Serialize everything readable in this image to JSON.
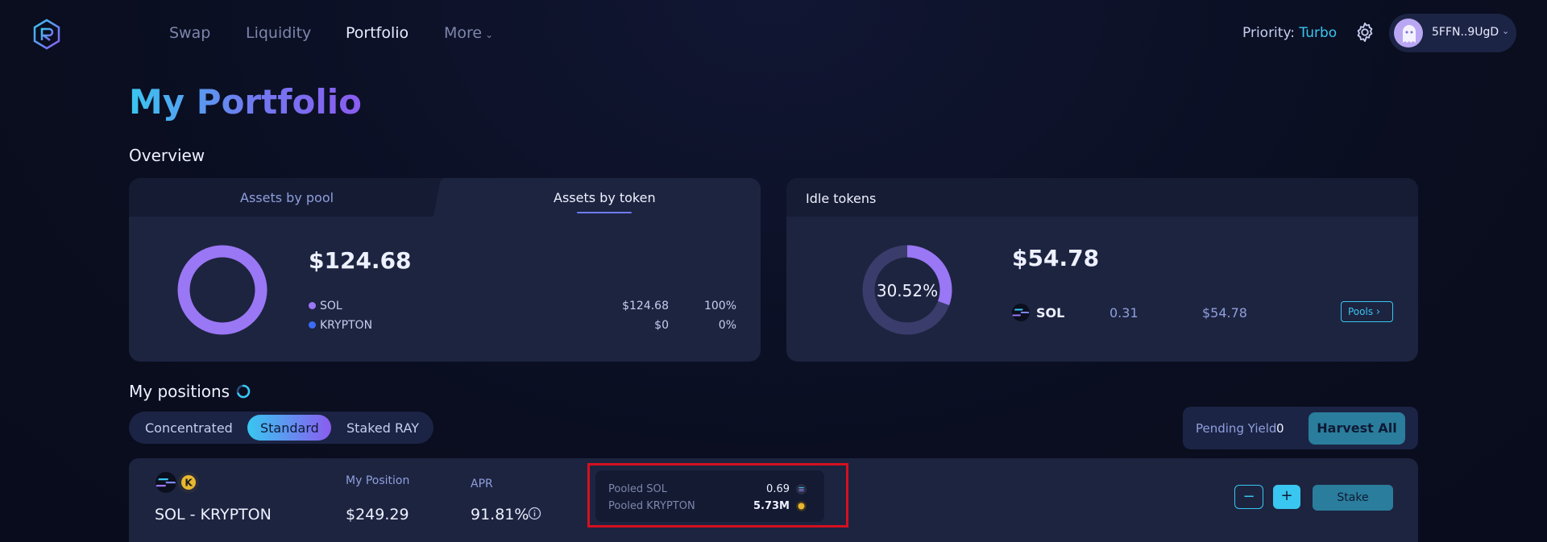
{
  "nav": {
    "links": [
      "Swap",
      "Liquidity",
      "Portfolio",
      "More"
    ],
    "priority_label": "Priority:",
    "priority_value": "Turbo",
    "wallet_address": "5FFN..9UgD"
  },
  "page": {
    "title": "My Portfolio",
    "overview_title": "Overview",
    "positions_title": "My positions"
  },
  "assets_card": {
    "tabs": [
      "Assets by pool",
      "Assets by token"
    ],
    "active_tab": "Assets by token",
    "total": "$124.68",
    "rows": [
      {
        "token": "SOL",
        "value": "$124.68",
        "percent": "100%",
        "color": "#9a77f4"
      },
      {
        "token": "KRYPTON",
        "value": "$0",
        "percent": "0%",
        "color": "#3b6cf5"
      }
    ],
    "donut_fraction": 1.0
  },
  "idle_card": {
    "title": "Idle tokens",
    "total": "$54.78",
    "donut_label": "30.52%",
    "donut_fraction": 0.3052,
    "token": "SOL",
    "amount": "0.31",
    "value": "$54.78",
    "pools_button": "Pools"
  },
  "positions": {
    "segments": [
      "Concentrated",
      "Standard",
      "Staked RAY"
    ],
    "active_segment": "Standard",
    "pending_yield_label": "Pending Yield",
    "pending_yield_value": "0",
    "harvest_button": "Harvest All",
    "rows": [
      {
        "pair": "SOL - KRYPTON",
        "my_position_label": "My Position",
        "my_position_value": "$249.29",
        "apr_label": "APR",
        "apr_value": "91.81%",
        "pooled": [
          {
            "label": "Pooled SOL",
            "value": "0.69"
          },
          {
            "label": "Pooled KRYPTON",
            "value": "5.73M"
          }
        ],
        "minus_button": "−",
        "plus_button": "+",
        "stake_button": "Stake"
      }
    ]
  },
  "colors": {
    "accent_cyan": "#39c6f0",
    "accent_purple": "#8a5cf0",
    "card_bg": "#1d2440",
    "highlight_red": "#d4101f"
  }
}
